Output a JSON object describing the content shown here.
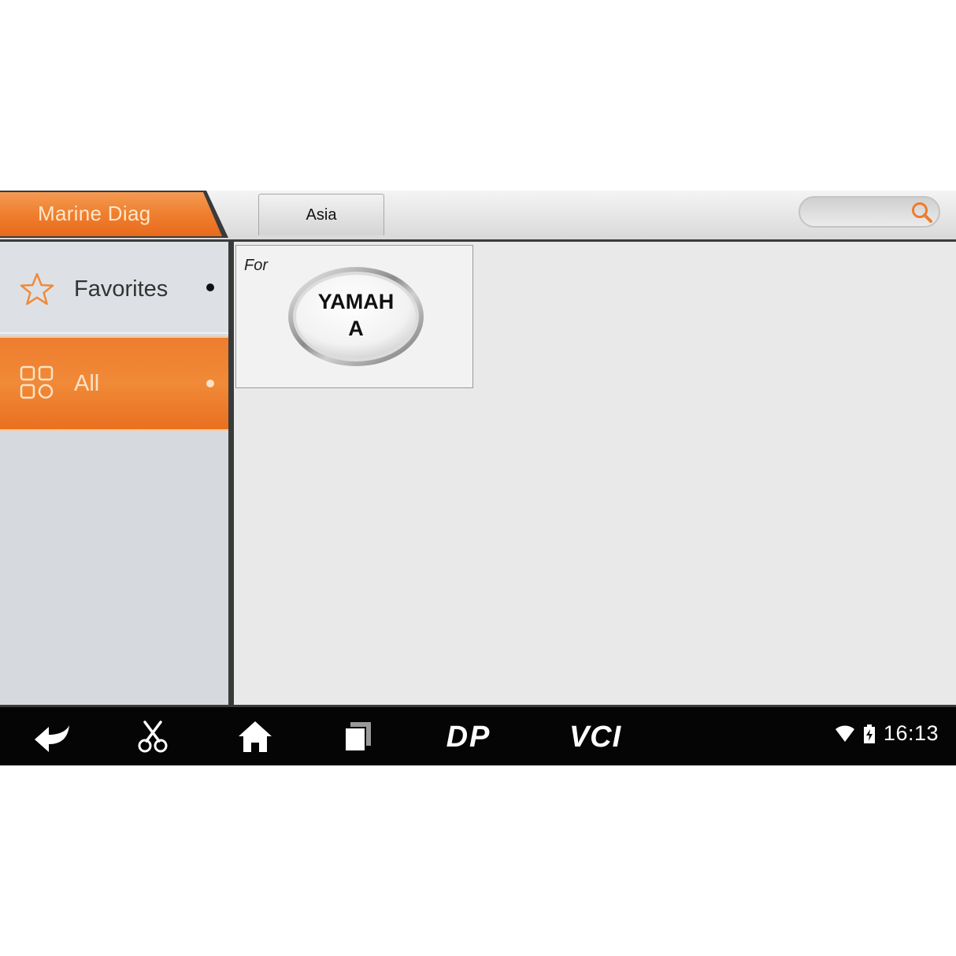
{
  "header": {
    "title": "Marine Diag",
    "region_tab": "Asia",
    "search": {
      "placeholder": "",
      "value": ""
    }
  },
  "sidebar": {
    "items": [
      {
        "label": "Favorites",
        "icon": "star-icon",
        "selected": false
      },
      {
        "label": "All",
        "icon": "grid-icon",
        "selected": true
      }
    ]
  },
  "content": {
    "cards": [
      {
        "prefix": "For",
        "brand_line1": "YAMAH",
        "brand_line2": "A"
      }
    ]
  },
  "navbar": {
    "buttons": [
      "back-icon",
      "scissors-icon",
      "home-icon",
      "recent-apps-icon",
      "dp-icon",
      "vci-icon"
    ],
    "dp_label": "DP",
    "vci_label": "VCI",
    "clock": "16:13"
  },
  "colors": {
    "accent": "#f07f2e",
    "accent_text": "#fde7c9",
    "navbar": "#050505",
    "content_bg": "#e9e9e9",
    "sidebar_bg": "#d6dade"
  }
}
